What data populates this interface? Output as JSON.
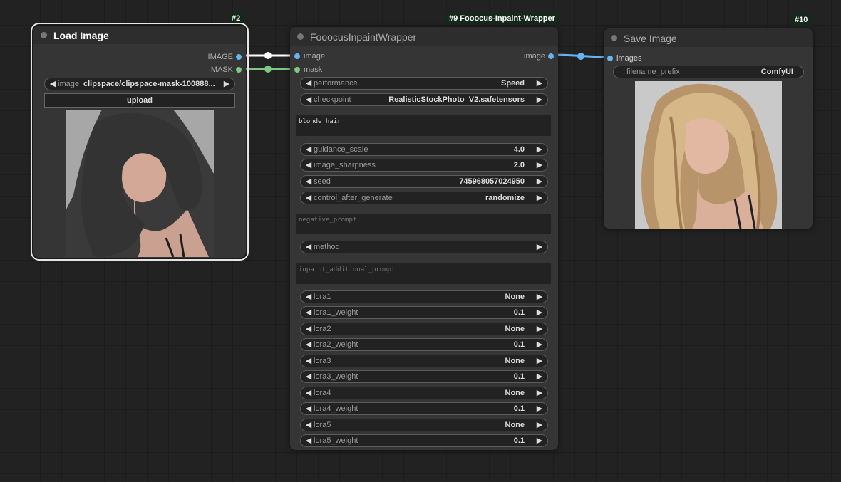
{
  "colors": {
    "canvas_bg": "#222222",
    "node_bg": "#353535",
    "image_link": "#ffffff",
    "mask_link": "#81c784",
    "images_link": "#64b5f6",
    "image_slot": "#64b5f6",
    "mask_slot": "#81c784"
  },
  "load_image": {
    "badge": "#2",
    "title": "Load Image",
    "outputs": {
      "image": "IMAGE",
      "mask": "MASK"
    },
    "image_widget": {
      "label": "image",
      "value": "clipspace/clipspace-mask-100888..."
    },
    "upload_label": "upload"
  },
  "wrapper": {
    "badge": "#9 Fooocus-Inpaint-Wrapper",
    "title": "FooocusInpaintWrapper",
    "inputs": {
      "image": "image",
      "mask": "mask"
    },
    "output_image": "image",
    "widgets": [
      {
        "label": "performance",
        "value": "Speed"
      },
      {
        "label": "checkpoint",
        "value": "RealisticStockPhoto_V2.safetensors"
      }
    ],
    "prompt": "blonde hair",
    "widgets2": [
      {
        "label": "guidance_scale",
        "value": "4.0"
      },
      {
        "label": "image_sharpness",
        "value": "2.0"
      },
      {
        "label": "seed",
        "value": "745968057024950"
      },
      {
        "label": "control_after_generate",
        "value": "randomize"
      }
    ],
    "negative_prompt_placeholder": "negative_prompt",
    "method": {
      "label": "method",
      "value": ""
    },
    "inpaint_prompt_placeholder": "inpaint_additional_prompt",
    "loras": [
      {
        "label": "lora1",
        "value": "None"
      },
      {
        "label": "lora1_weight",
        "value": "0.1"
      },
      {
        "label": "lora2",
        "value": "None"
      },
      {
        "label": "lora2_weight",
        "value": "0.1"
      },
      {
        "label": "lora3",
        "value": "None"
      },
      {
        "label": "lora3_weight",
        "value": "0.1"
      },
      {
        "label": "lora4",
        "value": "None"
      },
      {
        "label": "lora4_weight",
        "value": "0.1"
      },
      {
        "label": "lora5",
        "value": "None"
      },
      {
        "label": "lora5_weight",
        "value": "0.1"
      }
    ]
  },
  "save_image": {
    "badge": "#10",
    "title": "Save Image",
    "input_images": "images",
    "filename_prefix": {
      "label": "filename_prefix",
      "value": "ComfyUI"
    }
  }
}
